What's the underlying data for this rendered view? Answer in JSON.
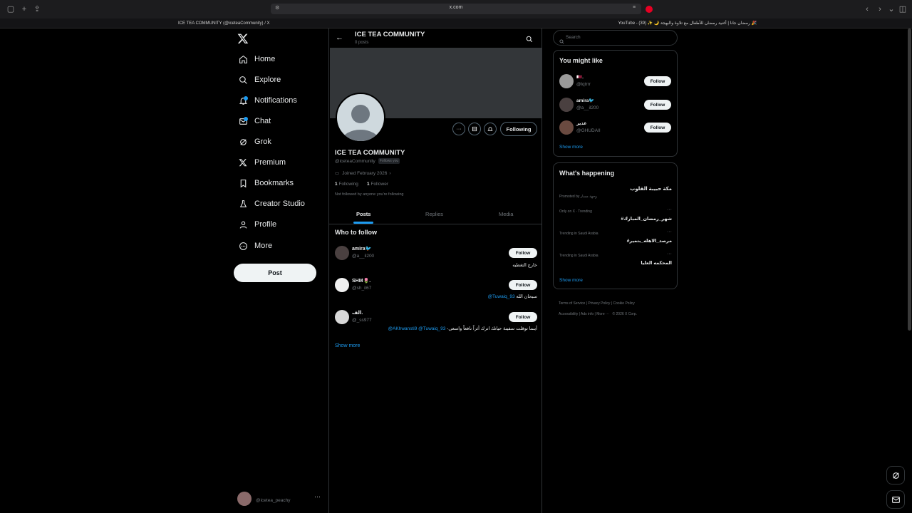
{
  "browser": {
    "url": "x.com",
    "tab_left": "ICE TEA COMMUNITY (@iceteaCommunity) / X",
    "tab_right": "YouTube - رمضان جانا | أغنية رمضان للأطفال مع تلاوة والبهجة 🌙 ✨ (39) 🎉"
  },
  "sidebar": {
    "items": [
      {
        "label": "Home",
        "icon": "home-icon"
      },
      {
        "label": "Explore",
        "icon": "search-icon"
      },
      {
        "label": "Notifications",
        "icon": "bell-icon"
      },
      {
        "label": "Chat",
        "icon": "mail-icon"
      },
      {
        "label": "Grok",
        "icon": "grok-icon"
      },
      {
        "label": "Premium",
        "icon": "x-logo-icon"
      },
      {
        "label": "Bookmarks",
        "icon": "bookmark-icon"
      },
      {
        "label": "Creator Studio",
        "icon": "flask-icon"
      },
      {
        "label": "Profile",
        "icon": "person-icon"
      },
      {
        "label": "More",
        "icon": "more-circle-icon"
      }
    ],
    "post_label": "Post",
    "account_handle": "@icetea_peachy"
  },
  "header": {
    "title": "ICE TEA COMMUNITY",
    "subtitle": "0 posts"
  },
  "profile": {
    "name": "ICE TEA COMMUNITY",
    "handle": "@iceteaCommunity",
    "follows_you": "Follows you",
    "joined": "Joined February 2026",
    "following_count": "1",
    "following_label": "Following",
    "followers_count": "1",
    "followers_label": "Follower",
    "not_followed": "Not followed by anyone you're following",
    "following_button": "Following"
  },
  "tabs": [
    "Posts",
    "Replies",
    "Media"
  ],
  "who_to_follow": {
    "title": "Who to follow",
    "items": [
      {
        "name": "amira🐦",
        "handle": "@a__il200",
        "bio": "خارج التغطيه",
        "bio_link": ""
      },
      {
        "name": "SHM🌷.",
        "handle": "@sh_il67",
        "bio": "سبحان الله",
        "bio_link": "@Tuwaiq_93"
      },
      {
        "name": "الف.",
        "handle": "@_ss977",
        "bio": "-أينما توقلت سفينة حياتك اترك أثراً نافعاً واسعى",
        "bio_link": "@AKhwansti9 @Tuwaiq_93"
      }
    ],
    "follow_label": "Follow",
    "show_more": "Show more"
  },
  "right": {
    "search_placeholder": "Search",
    "might_like_title": "You might like",
    "suggestions": [
      {
        "name": "🇶🇦.",
        "handle": "@lqtrrr"
      },
      {
        "name": "amira🐦",
        "handle": "@a__il200"
      },
      {
        "name": "غدير",
        "handle": "@GHUDAII"
      }
    ],
    "follow_label": "Follow",
    "show_more": "Show more",
    "happening_title": "What's happening",
    "trends": [
      {
        "meta": "",
        "topic": "مكة حبيبة القلوب",
        "promoted": "Promoted by وجهة مسار"
      },
      {
        "meta": "Only on X · Trending",
        "topic": "#شهر_رمضان_المبارك",
        "promoted": ""
      },
      {
        "meta": "Trending in Saudi Arabia",
        "topic": "#مرصد_الاهله_بتمير",
        "promoted": ""
      },
      {
        "meta": "Trending in Saudi Arabia",
        "topic": "المحكمه العليا",
        "promoted": ""
      }
    ],
    "footer": [
      "Terms of Service",
      "Privacy Policy",
      "Cookie Policy",
      "Accessibility",
      "Ads info",
      "More ···",
      "© 2026 X Corp."
    ]
  },
  "colors": {
    "accent": "#1d9bf0",
    "background": "#000000",
    "border": "#2f3336",
    "muted": "#71767b"
  }
}
